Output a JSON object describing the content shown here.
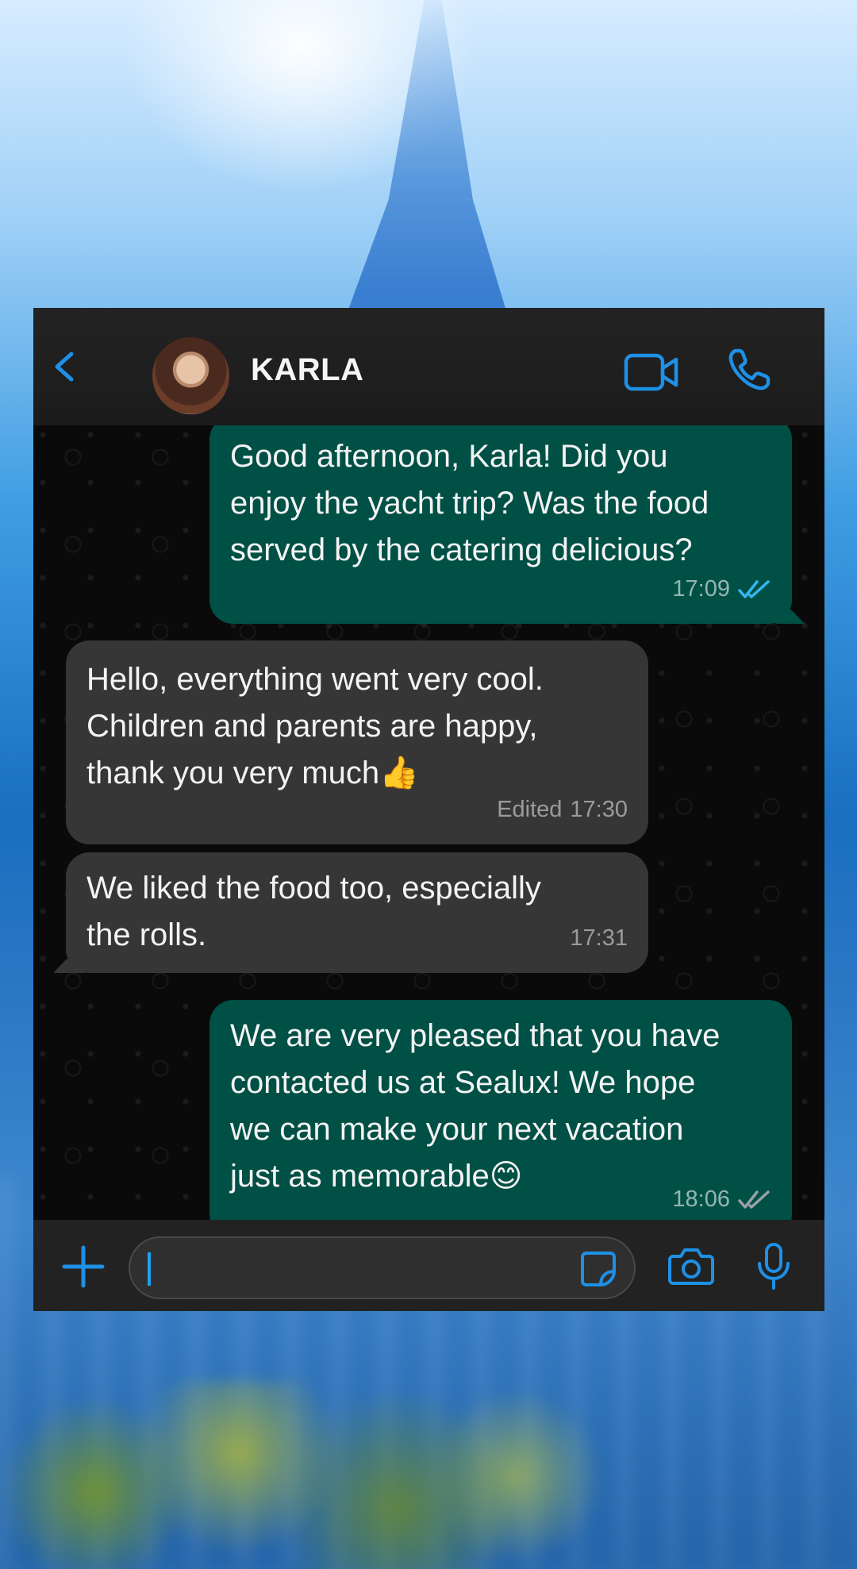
{
  "header": {
    "contact_name": "KARLA",
    "back_icon": "chevron-left-icon",
    "video_call_icon": "video-camera-icon",
    "voice_call_icon": "phone-icon"
  },
  "messages": [
    {
      "direction": "outgoing",
      "text": "Good afternoon, Karla! Did you\nenjoy the yacht trip? Was the food\nserved by the catering delicious?",
      "time": "17:09",
      "status": "read"
    },
    {
      "direction": "incoming",
      "text": "Hello, everything went very cool.\nChildren and parents are happy,\nthank you very much",
      "emoji": "👍",
      "edited_label": "Edited",
      "time": "17:30"
    },
    {
      "direction": "incoming",
      "text": "We liked the food too, especially\nthe rolls.",
      "time": "17:31"
    },
    {
      "direction": "outgoing",
      "text": "We are very pleased that you have\ncontacted us at Sealux! We hope\nwe can make your next vacation\njust as memorable",
      "emoji": "😊",
      "time": "18:06",
      "status": "delivered"
    }
  ],
  "input": {
    "value": "",
    "attach_icon": "plus-icon",
    "sticker_icon": "sticker-icon",
    "camera_icon": "camera-icon",
    "mic_icon": "microphone-icon"
  },
  "colors": {
    "accent": "#1e90e6",
    "outgoing_bubble": "#005046",
    "incoming_bubble": "#363636",
    "read_ticks": "#34b7f1",
    "delivered_ticks": "#9aa0a6"
  }
}
